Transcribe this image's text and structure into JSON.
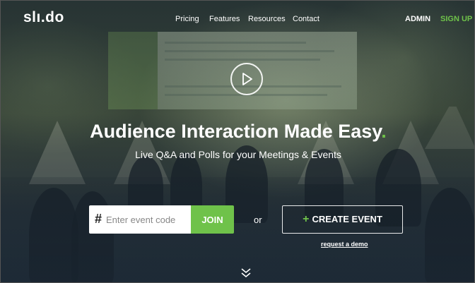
{
  "header": {
    "logo": "slı.do",
    "nav": [
      "Pricing",
      "Features",
      "Resources",
      "Contact"
    ],
    "admin": "ADMIN",
    "signup": "SIGN UP"
  },
  "hero": {
    "headline": "Audience Interaction Made Easy",
    "headline_dot": ".",
    "subhead": "Live Q&A and Polls for your Meetings & Events"
  },
  "form": {
    "hash": "#",
    "placeholder": "Enter event code",
    "join": "JOIN",
    "or": "or",
    "create_plus": "+",
    "create": "CREATE EVENT",
    "demo": "request a demo"
  },
  "colors": {
    "accent": "#6fc24a"
  },
  "icons": {
    "play": "play-icon",
    "scroll": "double-chevron-down-icon"
  }
}
